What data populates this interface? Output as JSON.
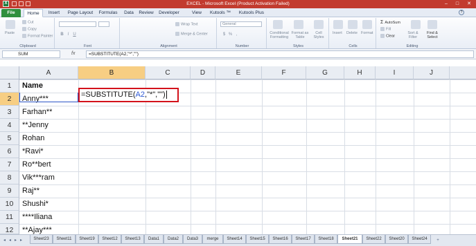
{
  "window": {
    "title": "EXCEL - Microsoft Excel (Product Activation Failed)",
    "min": "–",
    "max": "□",
    "close": "✕"
  },
  "tabs": [
    {
      "label": "File"
    },
    {
      "label": "Home"
    },
    {
      "label": "Insert"
    },
    {
      "label": "Page Layout"
    },
    {
      "label": "Formulas"
    },
    {
      "label": "Data"
    },
    {
      "label": "Review"
    },
    {
      "label": "Developer"
    },
    {
      "label": "View"
    },
    {
      "label": "Kutools ™"
    },
    {
      "label": "Kutools Plus"
    }
  ],
  "ribbon": {
    "clipboard": {
      "label": "Clipboard",
      "paste": "Paste",
      "cut": "Cut",
      "copy": "Copy",
      "format_painter": "Format Painter"
    },
    "font": {
      "label": "Font",
      "bold": "B",
      "italic": "I",
      "underline": "U"
    },
    "alignment": {
      "label": "Alignment",
      "wrap_text": "Wrap Text",
      "merge_center": "Merge & Center"
    },
    "number": {
      "label": "Number",
      "format": "General",
      "currency": "$",
      "percent": "%",
      "comma": ","
    },
    "styles": {
      "label": "Styles",
      "conditional": "Conditional Formatting",
      "format_table": "Format as Table",
      "cell_styles": "Cell Styles"
    },
    "cells": {
      "label": "Cells",
      "insert": "Insert",
      "delete": "Delete",
      "format": "Format"
    },
    "editing": {
      "label": "Editing",
      "autosum": "AutoSum",
      "fill": "Fill",
      "clear": "Clear",
      "sort_filter": "Sort & Filter",
      "find_select": "Find & Select"
    }
  },
  "formula_bar": {
    "name_box": "SUM",
    "fx": "fx",
    "formula": "=SUBSTITUTE(A2,\"*\",\"\")"
  },
  "columns": [
    "A",
    "B",
    "C",
    "D",
    "E",
    "F",
    "G",
    "H",
    "I",
    "J"
  ],
  "rows": [
    "1",
    "2",
    "3",
    "4",
    "5",
    "6",
    "7",
    "8",
    "9",
    "10",
    "11",
    "12"
  ],
  "cells": {
    "A1": "Name",
    "A2": "Anny***",
    "A3": "Farhan**",
    "A4": "**Jenny",
    "A5": "Rohan",
    "A6": "*Ravi*",
    "A7": "Ro**bert",
    "A8": "Vik***ram",
    "A9": "Raj**",
    "A10": "Shushi*",
    "A11": "****Iliana",
    "A12": "**Ajay***"
  },
  "edit_cell": {
    "prefix": "=SUBSTITUTE(",
    "ref": "A2",
    "suffix": ",\"*\",\"\")"
  },
  "sheets": [
    "Sheet23",
    "Sheet11",
    "Sheet19",
    "Sheet12",
    "Sheet13",
    "Data1",
    "Data2",
    "Data3",
    "merge",
    "Sheet14",
    "Sheet15",
    "Sheet16",
    "Sheet17",
    "Sheet18",
    "Sheet21",
    "Sheet22",
    "Sheet20",
    "Sheet24"
  ],
  "active_sheet": "Sheet21",
  "colors": {
    "title_bar": "#c23b2f",
    "file_tab": "#2f8f3d",
    "selected_header": "#f7ce83",
    "edit_border": "#d3121b",
    "cell_ref": "#2b57d4"
  }
}
